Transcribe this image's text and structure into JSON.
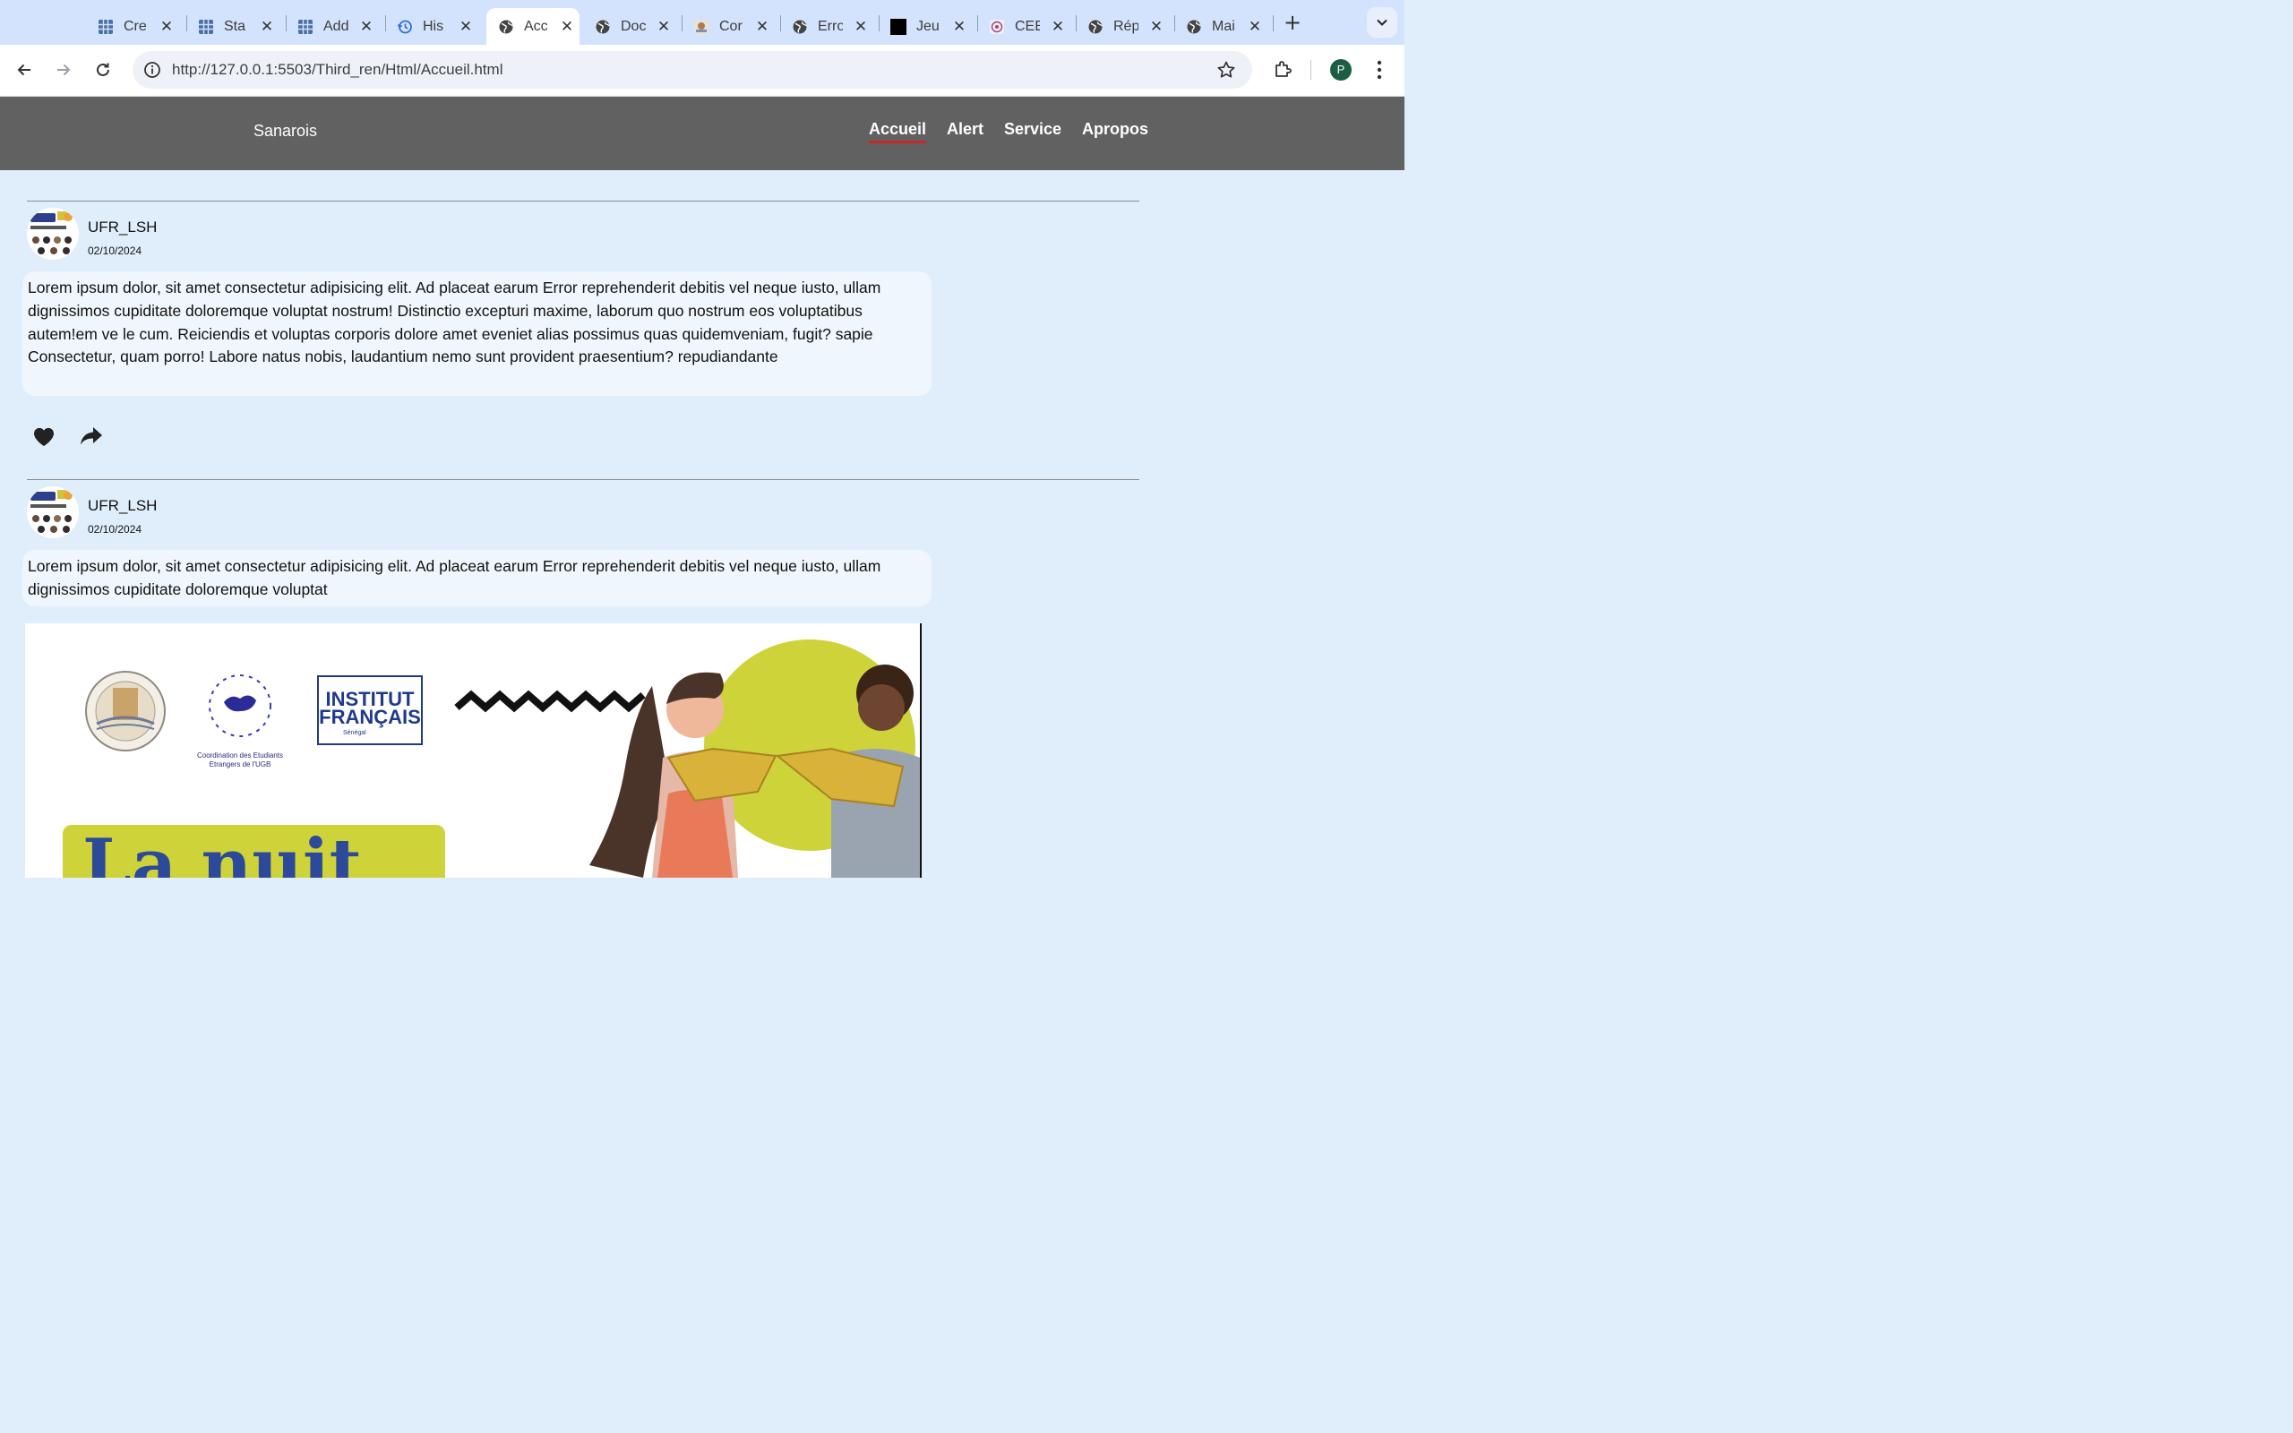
{
  "browser": {
    "tabs": [
      {
        "label": "Cre",
        "icon": "spreadsheet-icon",
        "active": false
      },
      {
        "label": "Sta",
        "icon": "spreadsheet-icon",
        "active": false
      },
      {
        "label": "Add",
        "icon": "spreadsheet-icon",
        "active": false
      },
      {
        "label": "His",
        "icon": "history-icon",
        "active": false
      },
      {
        "label": "Acc",
        "icon": "globe-icon",
        "active": true
      },
      {
        "label": "Doc",
        "icon": "globe-icon",
        "active": false
      },
      {
        "label": "Cor",
        "icon": "site-favicon-icon",
        "active": false
      },
      {
        "label": "Erro",
        "icon": "globe-icon",
        "active": false
      },
      {
        "label": "Jeu",
        "icon": "black-square-icon",
        "active": false
      },
      {
        "label": "CEE",
        "icon": "site-favicon-icon",
        "active": false
      },
      {
        "label": "Rép",
        "icon": "globe-icon",
        "active": false
      },
      {
        "label": "Mai",
        "icon": "globe-icon",
        "active": false
      }
    ],
    "close_glyph": "✕",
    "new_tab_glyph": "+",
    "url": "http://127.0.0.1:5503/Third_ren/Html/Accueil.html",
    "profile_initial": "P"
  },
  "site": {
    "brand": "Sanarois",
    "nav": [
      {
        "label": "Accueil",
        "active": true
      },
      {
        "label": "Alert",
        "active": false
      },
      {
        "label": "Service",
        "active": false
      },
      {
        "label": "Apropos",
        "active": false
      }
    ],
    "nav_active_color": "#c62828",
    "header_bg": "#616161",
    "page_bg": "#e0eefb"
  },
  "posts": [
    {
      "author": "UFR_LSH",
      "date": "02/10/2024",
      "text": "Lorem ipsum dolor, sit amet consectetur adipisicing elit. Ad placeat earum Error reprehenderit debitis vel neque iusto, ullam dignissimos cupiditate doloremque voluptat nostrum! Distinctio excepturi maxime, laborum quo nostrum eos voluptatibus autem!em ve le cum. Reiciendis et voluptas corporis dolore amet eveniet alias possimus quas quidemveniam, fugit? sapie Consectetur, quam porro! Labore natus nobis, laudantium nemo sunt provident praesentium? repudiandante",
      "actions": [
        "heart-icon",
        "share-icon"
      ]
    },
    {
      "author": "UFR_LSH",
      "date": "02/10/2024",
      "text": "Lorem ipsum dolor, sit amet consectetur adipisicing elit. Ad placeat earum Error reprehenderit debitis vel neque iusto, ullam dignissimos cupiditate doloremque voluptat",
      "poster": {
        "seal_text": "UNIVERSITE GASTON BERGER · SAINT-LOUIS DU SENEGAL",
        "coordination_caption_line1": "Coordination des Etudiants",
        "coordination_caption_line2": "Etrangers de l'UGB",
        "institut_line1": "INSTITUT",
        "institut_line2": "FRANÇAIS",
        "institut_sub": "Sénégal",
        "headline_partial": "La nuit"
      }
    }
  ]
}
